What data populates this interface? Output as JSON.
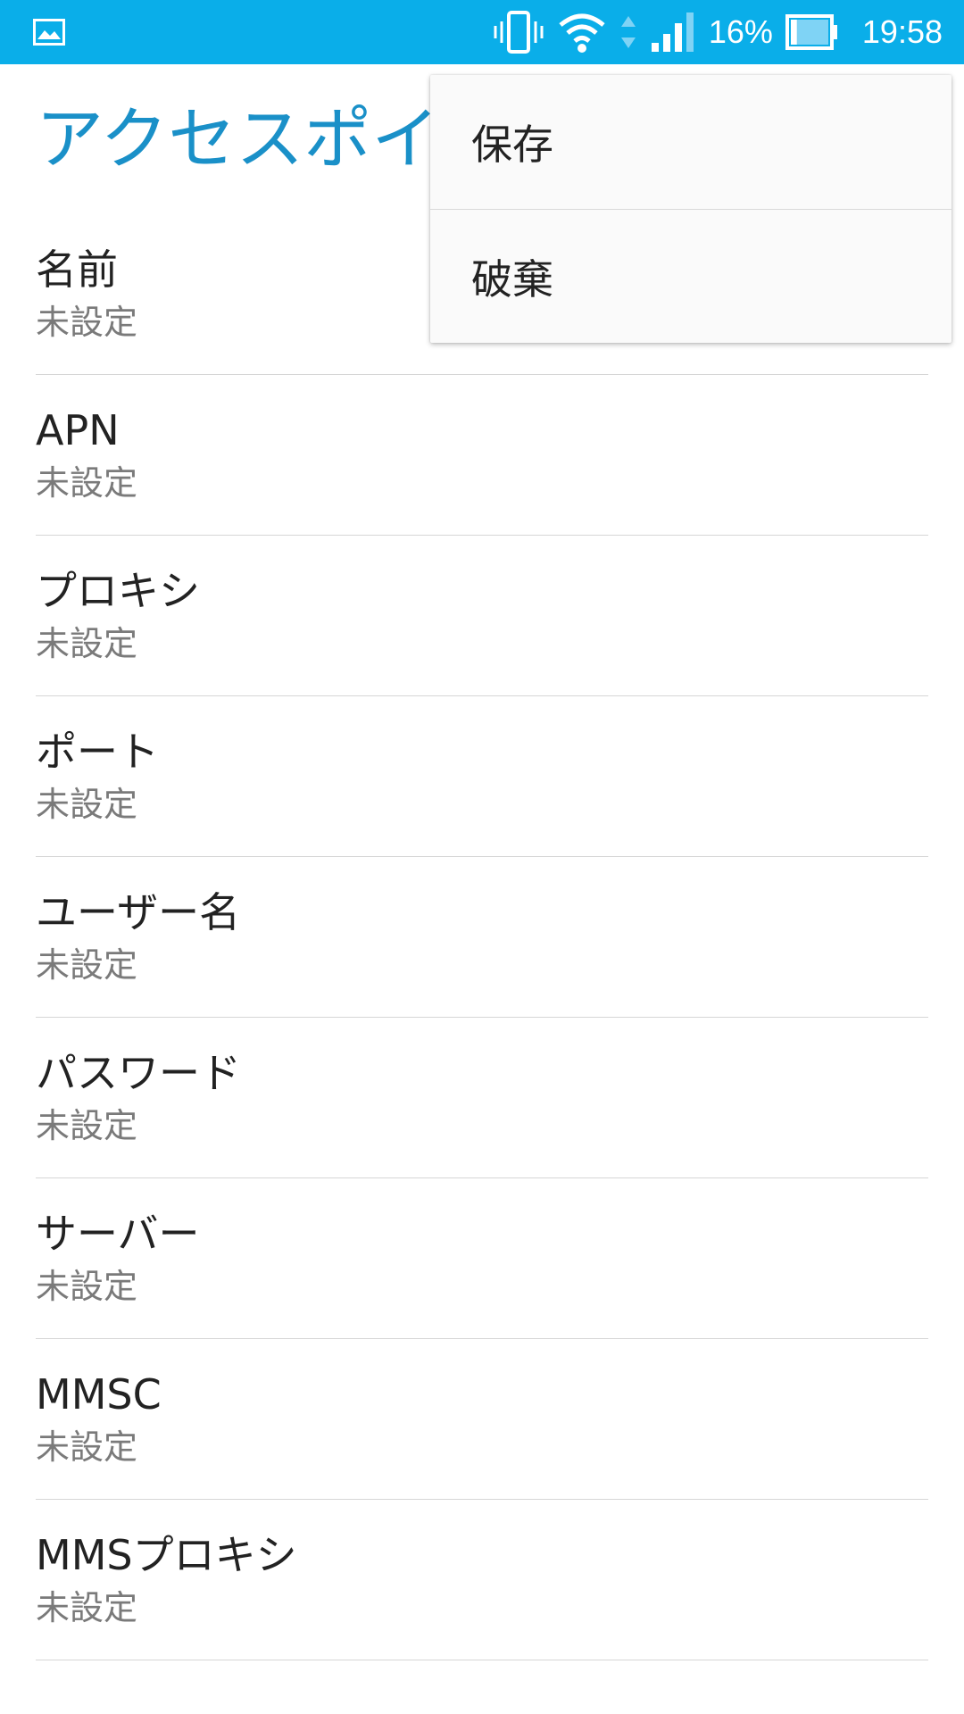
{
  "status_bar": {
    "left_icon": "gallery-image-icon",
    "icons": [
      "vibrate-icon",
      "wifi-icon",
      "data-arrows-icon",
      "signal-icon",
      "battery-icon"
    ],
    "battery_percent": "16%",
    "battery_level": 0.16,
    "time": "19:58",
    "bg_color": "#0aaee9"
  },
  "page": {
    "title": "アクセスポイ",
    "title_color": "#1a90c8"
  },
  "settings": [
    {
      "title": "名前",
      "value": "未設定"
    },
    {
      "title": "APN",
      "value": "未設定"
    },
    {
      "title": "プロキシ",
      "value": "未設定"
    },
    {
      "title": "ポート",
      "value": "未設定"
    },
    {
      "title": "ユーザー名",
      "value": "未設定"
    },
    {
      "title": "パスワード",
      "value": "未設定"
    },
    {
      "title": "サーバー",
      "value": "未設定"
    },
    {
      "title": "MMSC",
      "value": "未設定"
    },
    {
      "title": "MMSプロキシ",
      "value": "未設定"
    }
  ],
  "overflow_menu": {
    "items": [
      {
        "label": "保存"
      },
      {
        "label": "破棄"
      }
    ]
  }
}
